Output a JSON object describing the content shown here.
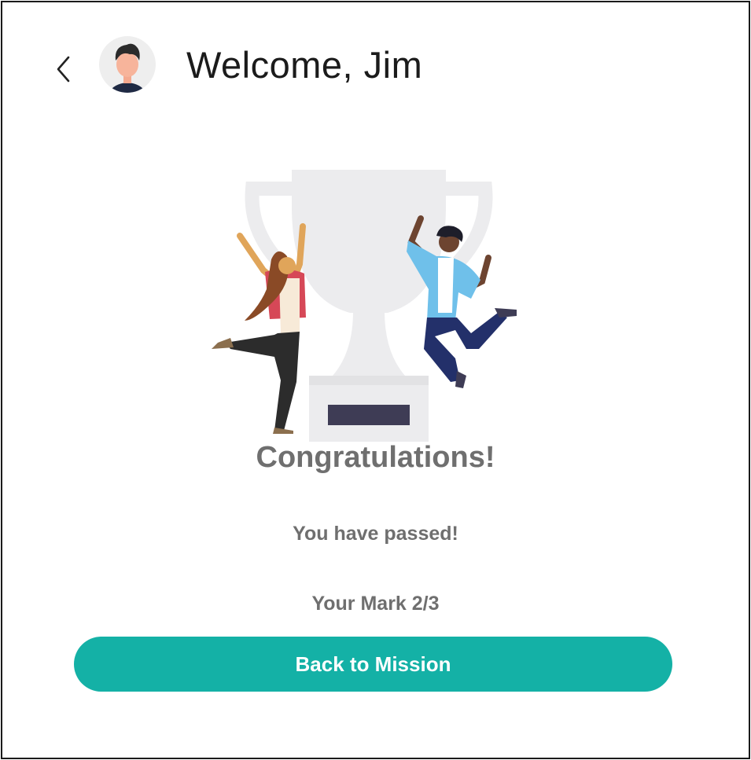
{
  "header": {
    "welcome_text": "Welcome, Jim",
    "back_icon": "chevron-left-icon",
    "avatar_icon": "user-avatar"
  },
  "result": {
    "title": "Congratulations!",
    "status": "You have passed!",
    "mark_text": "Your Mark 2/3",
    "illustration": "trophy-celebration-illustration"
  },
  "actions": {
    "back_to_mission_label": "Back to Mission"
  },
  "colors": {
    "accent": "#14b1a6",
    "text_muted": "#6f6f6f",
    "text_dark": "#1b1b1b"
  }
}
